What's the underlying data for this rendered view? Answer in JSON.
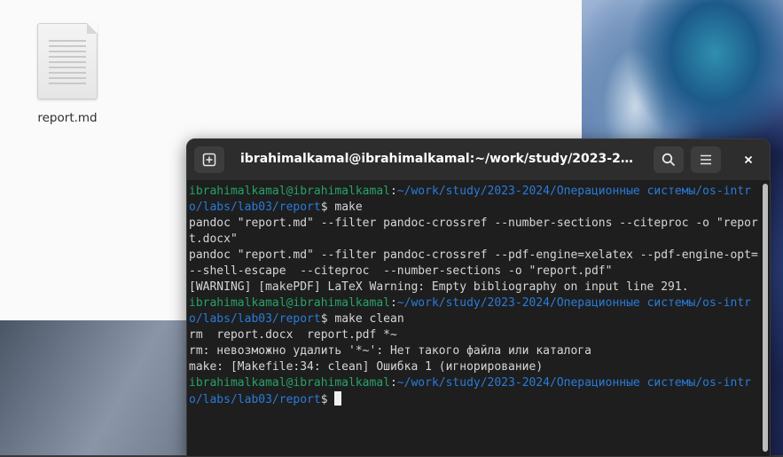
{
  "file_manager": {
    "files": [
      {
        "name": "report.md",
        "icon": "text-file-icon"
      }
    ]
  },
  "terminal": {
    "title": "ibrahimalkamal@ibrahimalkamal:~/work/study/2023-2024/Оп…",
    "buttons": {
      "new_tab_icon": "new-tab-icon",
      "search_icon": "search-icon",
      "menu_icon": "hamburger-menu-icon",
      "close_icon": "close-icon"
    },
    "prompt_user": "ibrahimalkamal@ibrahimalkamal",
    "prompt_path": "~/work/study/2023-2024/Операционные системы/os-intro/labs/lab03/report",
    "lines": [
      {
        "type": "prompt",
        "command": "make"
      },
      {
        "type": "output",
        "text": "pandoc \"report.md\" --filter pandoc-crossref --number-sections --citeproc -o \"report.docx\""
      },
      {
        "type": "output",
        "text": "pandoc \"report.md\" --filter pandoc-crossref --pdf-engine=xelatex --pdf-engine-opt=--shell-escape  --citeproc  --number-sections -o \"report.pdf\""
      },
      {
        "type": "output",
        "text": "[WARNING] [makePDF] LaTeX Warning: Empty bibliography on input line 291."
      },
      {
        "type": "prompt",
        "command": "make clean"
      },
      {
        "type": "output",
        "text": "rm  report.docx  report.pdf *~"
      },
      {
        "type": "output",
        "text": "rm: невозможно удалить '*~': Нет такого файла или каталога"
      },
      {
        "type": "output",
        "text": "make: [Makefile:34: clean] Ошибка 1 (игнорирование)"
      },
      {
        "type": "prompt",
        "command": ""
      }
    ]
  },
  "colors": {
    "prompt_user": "#26a269",
    "prompt_path": "#2a7bd8",
    "terminal_bg": "#1e1e1e",
    "header_bg": "#2d2d2d"
  }
}
